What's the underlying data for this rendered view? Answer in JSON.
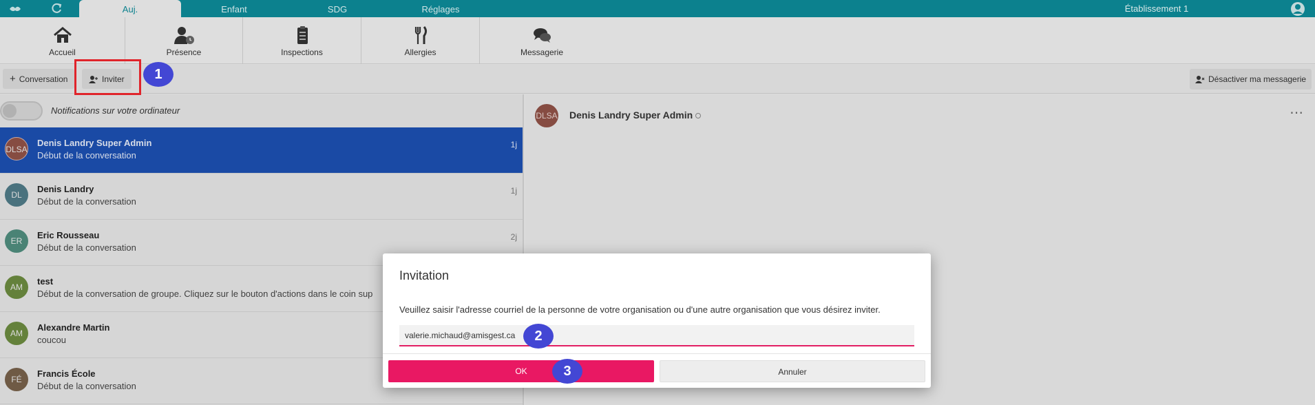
{
  "topbar": {
    "tabs": [
      {
        "label": "Auj."
      },
      {
        "label": "Enfant"
      },
      {
        "label": "SDG"
      },
      {
        "label": "Réglages"
      }
    ],
    "establishment": "Établissement 1"
  },
  "modules": [
    {
      "label": "Accueil",
      "icon": "home-icon"
    },
    {
      "label": "Présence",
      "icon": "user-clock-icon"
    },
    {
      "label": "Inspections",
      "icon": "clipboard-icon"
    },
    {
      "label": "Allergies",
      "icon": "utensils-icon"
    },
    {
      "label": "Messagerie",
      "icon": "chat-icon"
    }
  ],
  "actions": {
    "conversation_label": "Conversation",
    "invite_label": "Inviter",
    "disable_messaging_label": "Désactiver ma messagerie"
  },
  "notifications": {
    "label": "Notifications sur votre ordinateur",
    "enabled": false
  },
  "conversations": [
    {
      "initials": "DLSA",
      "name": "Denis Landry Super Admin",
      "message": "Début de la conversation",
      "time": "1j",
      "color": "#8f5147",
      "selected": true
    },
    {
      "initials": "DL",
      "name": "Denis Landry",
      "message": "Début de la conversation",
      "time": "1j",
      "color": "#4f7a86"
    },
    {
      "initials": "ER",
      "name": "Eric Rousseau",
      "message": "Début de la conversation",
      "time": "2j",
      "color": "#4f8c7d"
    },
    {
      "initials": "AM",
      "name": "test",
      "message": "Début de la conversation de groupe. Cliquez sur le bouton d'actions dans le coin sup",
      "time": "",
      "color": "#6b8a3f"
    },
    {
      "initials": "AM",
      "name": "Alexandre Martin",
      "message": "coucou",
      "time": "",
      "color": "#6b8a3f"
    },
    {
      "initials": "FÉ",
      "name": "Francis École",
      "message": "Début de la conversation",
      "time": "",
      "color": "#76604a"
    }
  ],
  "active_conversation": {
    "initials": "DLSA",
    "name": "Denis Landry Super Admin"
  },
  "modal": {
    "title": "Invitation",
    "text": "Veuillez saisir l'adresse courriel de la personne de votre organisation ou d'une autre organisation que vous désirez inviter.",
    "email_value": "valerie.michaud@amisgest.ca",
    "ok_label": "OK",
    "cancel_label": "Annuler"
  },
  "annotations": {
    "step1": "1",
    "step2": "2",
    "step3": "3"
  },
  "colors": {
    "topbar": "#0d8a97",
    "selected_row": "#1c4fb0",
    "primary_button": "#e91863",
    "step_badge": "#4347d4",
    "highlight_box": "#e0242b"
  }
}
